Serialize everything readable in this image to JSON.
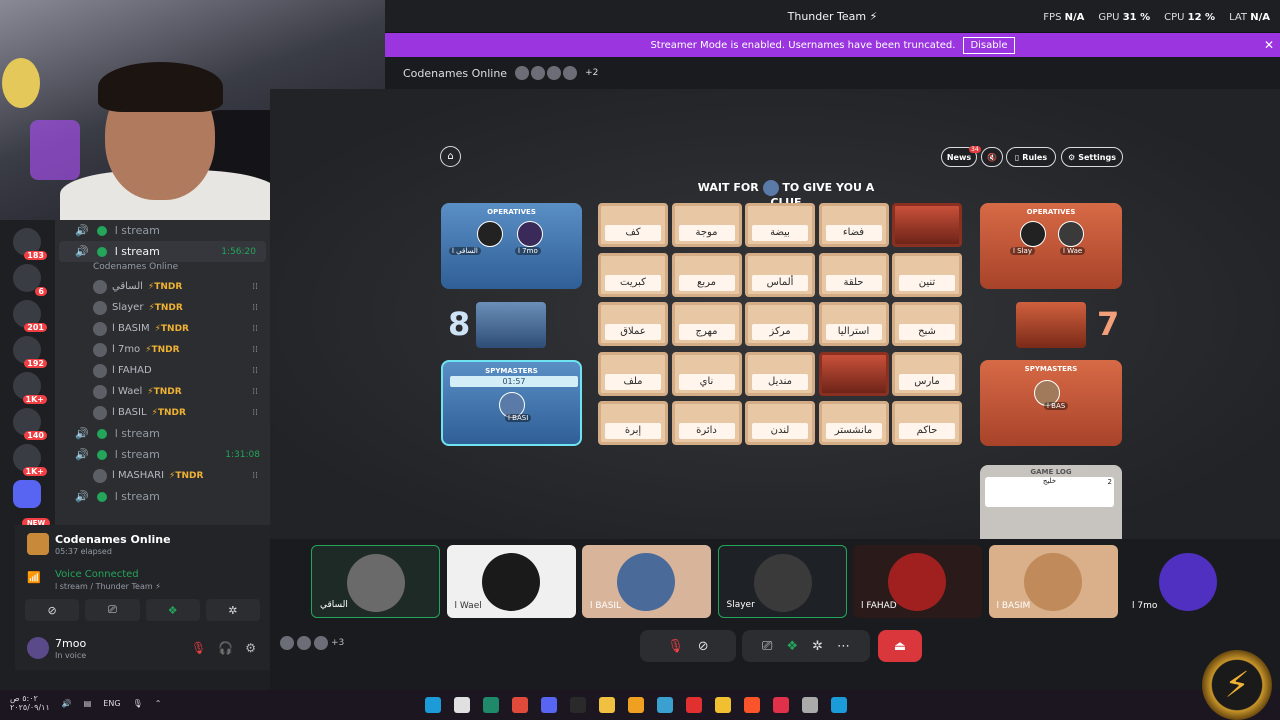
{
  "window": {
    "title": "Thunder Team ⚡"
  },
  "stats": {
    "fps_label": "FPS",
    "fps": "N/A",
    "gpu_label": "GPU",
    "gpu": "31 %",
    "cpu_label": "CPU",
    "cpu": "12 %",
    "lat_label": "LAT",
    "lat": "N/A"
  },
  "banner": {
    "text": "Streamer Mode is enabled. Usernames have been truncated.",
    "disable_label": "Disable"
  },
  "activity": {
    "title": "Codenames Online",
    "extra_count": "+2"
  },
  "servers": {
    "badges": [
      "183",
      "6",
      "201",
      "192",
      "1K+",
      "140",
      "1K+"
    ],
    "new_label": "NEW"
  },
  "channels": {
    "items": [
      {
        "name": "l stream",
        "time": ""
      },
      {
        "name": "l stream",
        "time": "1:56:20",
        "active": true,
        "sub": "Codenames Online"
      }
    ],
    "members_a": [
      {
        "name": "الساقي",
        "tag": "⚡TNDR"
      },
      {
        "name": "Slayer",
        "tag": "⚡TNDR"
      },
      {
        "name": "l BASIM",
        "tag": "⚡TNDR"
      },
      {
        "name": "l 7mo",
        "tag": "⚡TNDR"
      },
      {
        "name": "l FAHAD",
        "tag": ""
      },
      {
        "name": "l Wael",
        "tag": "⚡TNDR"
      },
      {
        "name": "l BASIL",
        "tag": "⚡TNDR"
      }
    ],
    "more": [
      {
        "name": "l stream",
        "time": ""
      },
      {
        "name": "l stream",
        "time": "1:31:08"
      }
    ],
    "members_b": [
      {
        "name": "l MASHARI",
        "tag": "⚡TNDR"
      }
    ],
    "last": {
      "name": "l stream"
    }
  },
  "panel": {
    "game_title": "Codenames Online",
    "game_elapsed": "05:37 elapsed",
    "voice_status": "Voice Connected",
    "voice_channel": "l stream / Thunder Team ⚡",
    "user_name": "7moo",
    "user_status": "In voice"
  },
  "game": {
    "toolbar": {
      "news": "News",
      "news_badge": "34",
      "rules": "Rules",
      "settings": "Settings"
    },
    "clue_prefix": "WAIT FOR",
    "clue_suffix": "TO GIVE YOU A CLUE",
    "blue": {
      "operatives_label": "OPERATIVES",
      "score": "8",
      "spymasters_label": "SPYMASTERS",
      "timer": "01:57",
      "ops": [
        "l الساقي",
        "l 7mo"
      ],
      "spy": "l BASI"
    },
    "red": {
      "operatives_label": "OPERATIVES",
      "score": "7",
      "spymasters_label": "SPYMASTERS",
      "ops": [
        "l Slay",
        "l Wae"
      ],
      "spy": "l BAS"
    },
    "log_label": "GAME LOG",
    "log_word": "خليج",
    "log_count": "2",
    "cards": [
      [
        "كف",
        "موجة",
        "بيضة",
        "فضاء",
        ""
      ],
      [
        "كبريت",
        "مربع",
        "ألماس",
        "حلقة",
        "تنين"
      ],
      [
        "عملاق",
        "مهرج",
        "مركز",
        "استراليا",
        "شبح"
      ],
      [
        "ملف",
        "ناي",
        "منديل",
        "",
        "مارس"
      ],
      [
        "إبرة",
        "دائرة",
        "لندن",
        "مانشستر",
        "حاكم"
      ]
    ]
  },
  "tiles": [
    {
      "name": "الساقي"
    },
    {
      "name": "l Wael"
    },
    {
      "name": "l BASIL"
    },
    {
      "name": "Slayer"
    },
    {
      "name": "l FAHAD"
    },
    {
      "name": "l BASIM"
    },
    {
      "name": "l 7mo"
    }
  ],
  "callbar": {
    "extra": "+3"
  },
  "taskbar": {
    "lang": "ENG",
    "date": "٢٠٢٥/٠٩/١١",
    "time": "٥:٠٢ ص"
  }
}
